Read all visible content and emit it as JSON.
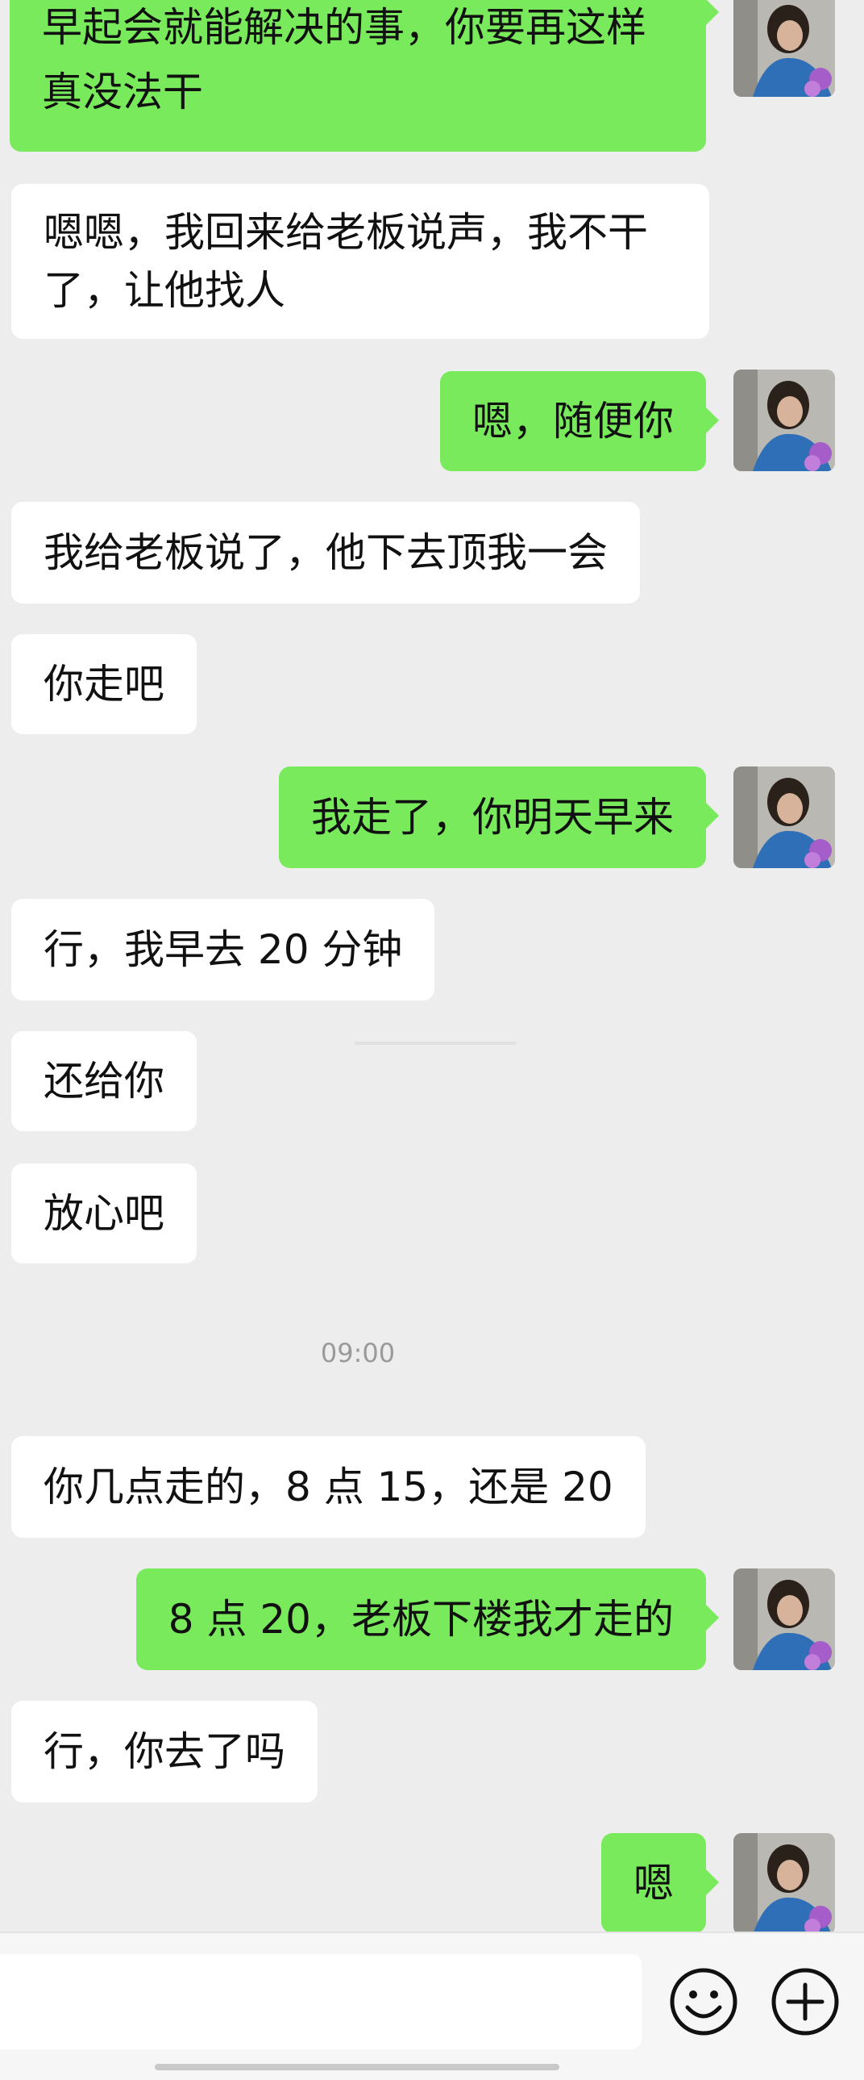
{
  "colors": {
    "background": "#ededed",
    "sent_bubble": "#79ea5b",
    "received_bubble": "#ffffff",
    "text": "#111111",
    "timestamp": "#9a9a9a"
  },
  "messages": [
    {
      "side": "sent",
      "text": "早起会就能解决的事，你要再这样真没法干"
    },
    {
      "side": "received",
      "text": "嗯嗯，我回来给老板说声，我不干了，让他找人"
    },
    {
      "side": "sent",
      "text": "嗯，随便你"
    },
    {
      "side": "received",
      "text": "我给老板说了，他下去顶我一会"
    },
    {
      "side": "received",
      "text": "你走吧"
    },
    {
      "side": "sent",
      "text": "我走了，你明天早来"
    },
    {
      "side": "received",
      "text": "行，我早去 20 分钟"
    },
    {
      "side": "received",
      "text": "还给你"
    },
    {
      "side": "received",
      "text": "放心吧"
    },
    {
      "side": "received",
      "text": "你几点走的，8 点 15，还是 20"
    },
    {
      "side": "sent",
      "text": "8 点 20，老板下楼我才走的"
    },
    {
      "side": "received",
      "text": "行，你去了吗"
    },
    {
      "side": "sent",
      "text": "嗯"
    }
  ],
  "timestamp": "09:00",
  "input_bar": {
    "message_value": "",
    "emoji_icon": "smiley-face-icon",
    "plus_icon": "plus-circle-icon"
  },
  "avatar_icon": "user-photo-avatar"
}
